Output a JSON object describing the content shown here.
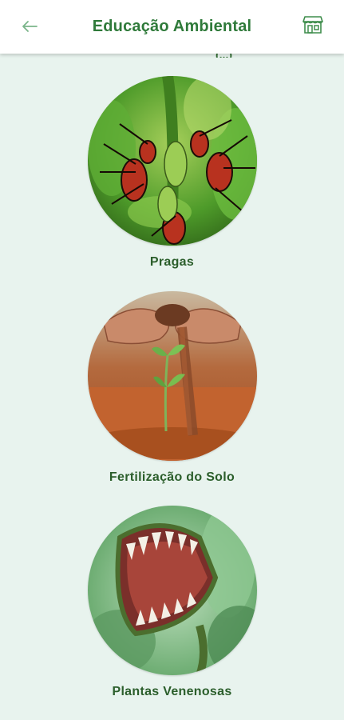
{
  "header": {
    "title": "Educação Ambiental",
    "back_icon": "arrow-left-icon",
    "store_icon": "storefront-icon"
  },
  "partial_previous_label": "(...)",
  "categories": [
    {
      "label": "Pragas",
      "image": "insect-pests-on-plant"
    },
    {
      "label": "Fertilização do Solo",
      "image": "hands-pouring-soil-on-seedling"
    },
    {
      "label": "Plantas Venenosas",
      "image": "carnivorous-venus-flytrap"
    }
  ],
  "colors": {
    "accent": "#2f7a3a",
    "background": "#e8f3ee",
    "label_text": "#2b5e2b"
  }
}
